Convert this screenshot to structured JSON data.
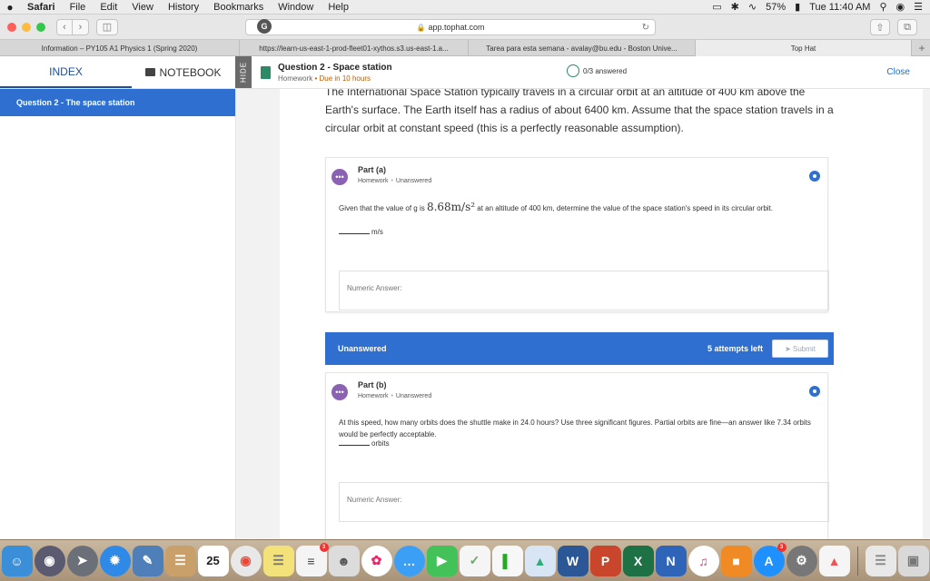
{
  "menubar": {
    "apple": "",
    "items": [
      "Safari",
      "File",
      "Edit",
      "View",
      "History",
      "Bookmarks",
      "Window",
      "Help"
    ],
    "battery": "57%",
    "clock": "Tue 11:40 AM"
  },
  "browser": {
    "url": "app.tophat.com",
    "google_glyph": "G",
    "tabs": [
      "Information – PY105 A1 Physics 1 (Spring 2020)",
      "https://learn-us-east-1-prod-fleet01-xythos.s3.us-east-1.a...",
      "Tarea para esta semana - avalay@bu.edu - Boston Unive...",
      "Top Hat"
    ]
  },
  "header": {
    "index_label": "INDEX",
    "notebook_label": "NOTEBOOK",
    "hide_label": "HIDE",
    "question_title": "Question 2 - Space station",
    "question_type": "Homework",
    "due": "Due in 10 hours",
    "answered": "0/3 answered",
    "close_label": "Close"
  },
  "sidebar": {
    "selected_item": "Question 2 - The space station"
  },
  "stem": {
    "line1": "The International Space Station typically travels in a circular orbit at an altitude of 400 km above the",
    "line2": "Earth's surface. The Earth itself has a radius of about 6400 km. Assume that the space station travels in a",
    "line3": "circular orbit at constant speed (this is a perfectly reasonable assumption)."
  },
  "part_a": {
    "title": "Part (a)",
    "type": "Homework",
    "status": "Unanswered",
    "text_before": "Given that the value of g is ",
    "math": "8.68m/s²",
    "text_after": " at an altitude of 400 km, determine the value of the space station's speed in its circular orbit.",
    "unit": "m/s",
    "placeholder": "Numeric Answer:"
  },
  "status_bar": {
    "status": "Unanswered",
    "attempts": "5 attempts left",
    "submit_label": "Submit"
  },
  "part_b": {
    "title": "Part (b)",
    "type": "Homework",
    "status": "Unanswered",
    "text": "At this speed, how many orbits does the shuttle make in 24.0 hours? Use three significant figures. Partial orbits are fine—an answer like 7.34 orbits would be perfectly acceptable.",
    "unit": "orbits",
    "placeholder": "Numeric Answer:"
  },
  "dock": {
    "calendar_day": "25",
    "badge_count": "3"
  },
  "colors": {
    "accent": "#2f6fd0",
    "bubble": "#8b62b3",
    "due": "#c45a00"
  }
}
